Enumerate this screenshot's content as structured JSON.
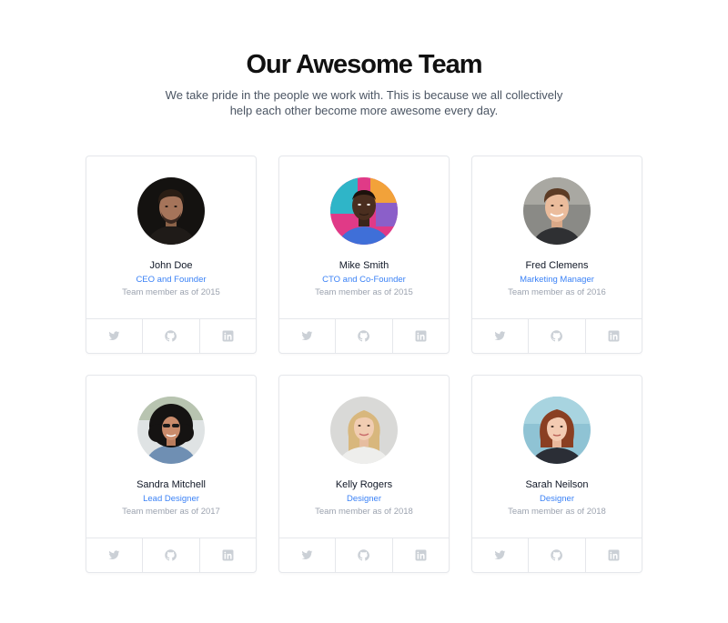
{
  "header": {
    "title": "Our Awesome Team",
    "subtitle": "We take pride in the people we work with. This is because we all collectively help each other become more awesome every day."
  },
  "colors": {
    "accent": "#3b82f6",
    "muted": "#9ca3af",
    "icon": "#cbd0d6",
    "border": "#e5e7eb"
  },
  "social_icons": [
    "twitter-icon",
    "github-icon",
    "linkedin-icon"
  ],
  "team": [
    {
      "name": "John Doe",
      "role": "CEO and Founder",
      "since": "Team member as of 2015"
    },
    {
      "name": "Mike Smith",
      "role": "CTO and Co-Founder",
      "since": "Team member as of 2015"
    },
    {
      "name": "Fred Clemens",
      "role": "Marketing Manager",
      "since": "Team member as of 2016"
    },
    {
      "name": "Sandra Mitchell",
      "role": "Lead Designer",
      "since": "Team member as of 2017"
    },
    {
      "name": "Kelly Rogers",
      "role": "Designer",
      "since": "Team member as of 2018"
    },
    {
      "name": "Sarah Neilson",
      "role": "Designer",
      "since": "Team member as of 2018"
    }
  ]
}
